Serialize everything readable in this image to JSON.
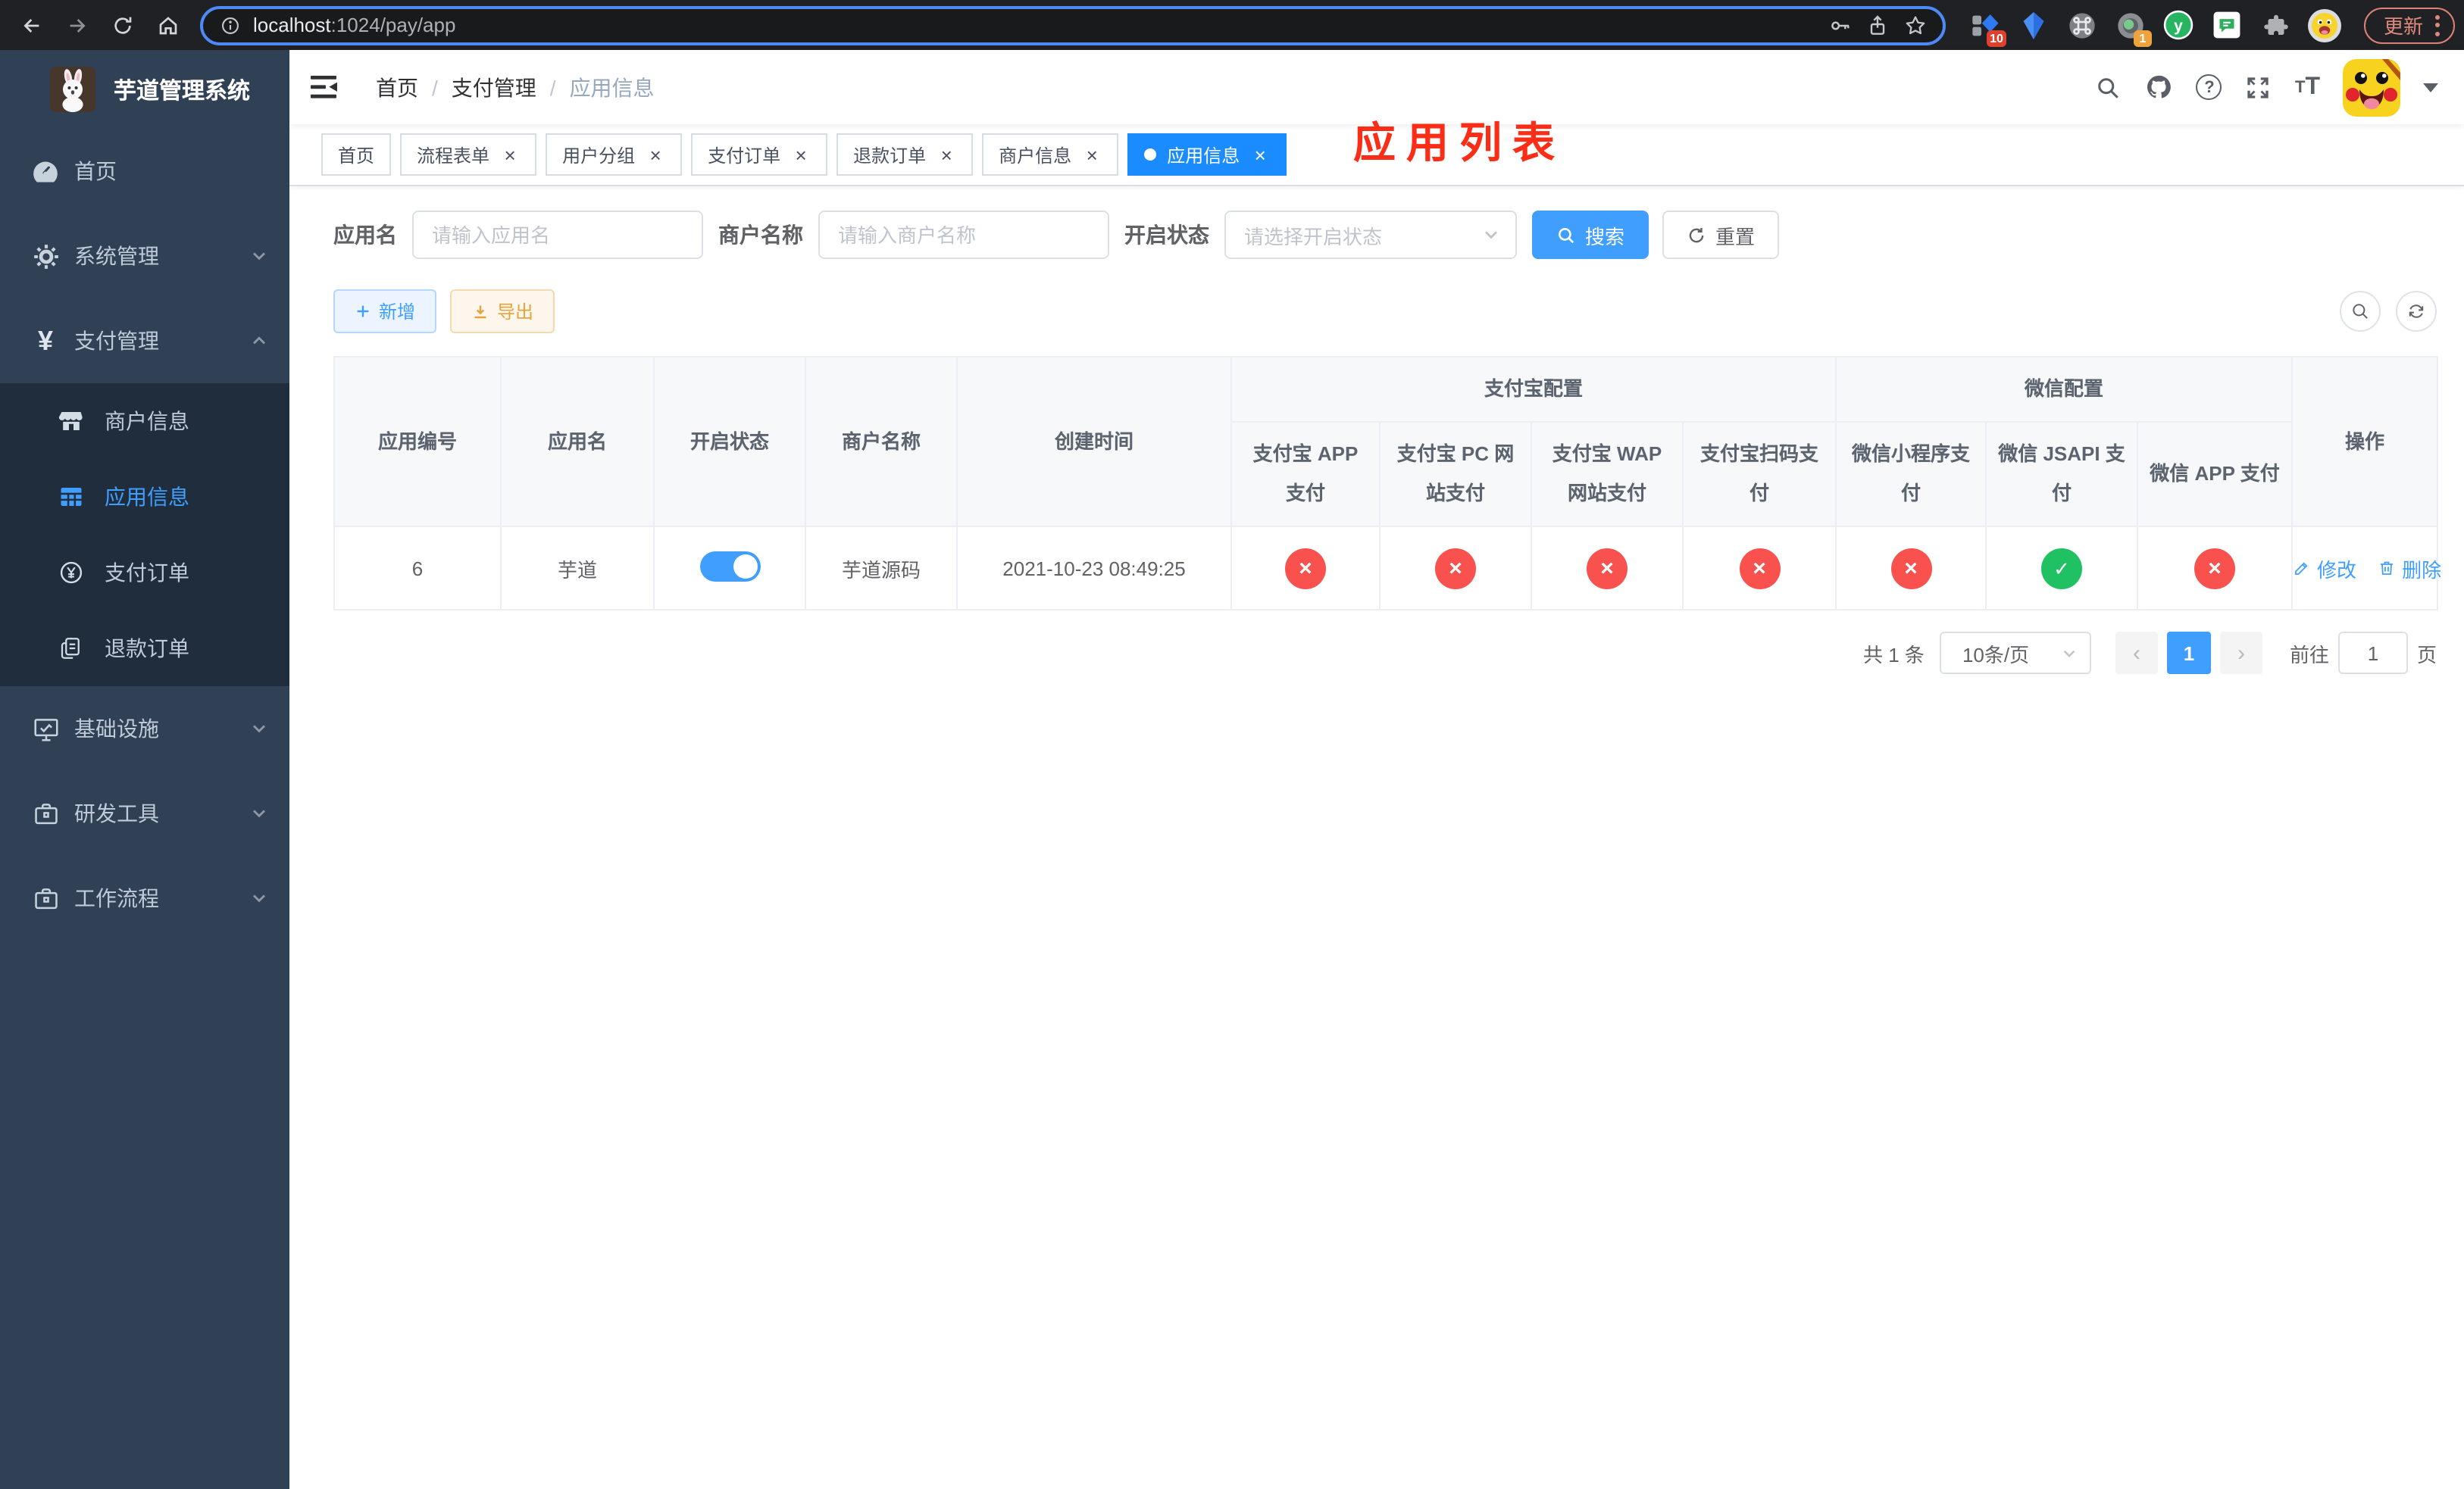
{
  "browser": {
    "url_host": "localhost",
    "url_path": ":1024/pay/app",
    "ext_badge_blue": "10",
    "ext_badge_lens": "1",
    "update_label": "更新"
  },
  "sidebar": {
    "title": "芋道管理系统",
    "items": [
      {
        "label": "首页"
      },
      {
        "label": "系统管理"
      },
      {
        "label": "支付管理"
      },
      {
        "label": "基础设施"
      },
      {
        "label": "研发工具"
      },
      {
        "label": "工作流程"
      }
    ],
    "pay_submenu": [
      {
        "label": "商户信息"
      },
      {
        "label": "应用信息"
      },
      {
        "label": "支付订单"
      },
      {
        "label": "退款订单"
      }
    ]
  },
  "navbar": {
    "breadcrumb": [
      "首页",
      "支付管理",
      "应用信息"
    ]
  },
  "header": {
    "page_title": "应用列表"
  },
  "tags": {
    "items": [
      {
        "label": "首页"
      },
      {
        "label": "流程表单"
      },
      {
        "label": "用户分组"
      },
      {
        "label": "支付订单"
      },
      {
        "label": "退款订单"
      },
      {
        "label": "商户信息"
      },
      {
        "label": "应用信息"
      }
    ]
  },
  "filters": {
    "app_name_label": "应用名",
    "app_name_placeholder": "请输入应用名",
    "merchant_label": "商户名称",
    "merchant_placeholder": "请输入商户名称",
    "status_label": "开启状态",
    "status_placeholder": "请选择开启状态",
    "search_label": "搜索",
    "reset_label": "重置"
  },
  "toolbar": {
    "add_label": "新增",
    "export_label": "导出"
  },
  "table": {
    "group_alipay": "支付宝配置",
    "group_wechat": "微信配置",
    "col_app_id": "应用编号",
    "col_app_name": "应用名",
    "col_status": "开启状态",
    "col_merchant": "商户名称",
    "col_create_time": "创建时间",
    "col_alipay_app": "支付宝 APP 支付",
    "col_alipay_pc": "支付宝 PC 网站支付",
    "col_alipay_wap": "支付宝 WAP 网站支付",
    "col_alipay_qr": "支付宝扫码支付",
    "col_wx_mini": "微信小程序支付",
    "col_wx_jsapi": "微信 JSAPI 支付",
    "col_wx_app": "微信 APP 支付",
    "col_actions": "操作",
    "row": {
      "app_id": "6",
      "app_name": "芋道",
      "enabled": "on",
      "merchant": "芋道源码",
      "create_time": "2021-10-23 08:49:25",
      "configs": [
        "no",
        "no",
        "no",
        "no",
        "no",
        "yes",
        "no"
      ],
      "edit_label": "修改",
      "delete_label": "删除"
    }
  },
  "pagination": {
    "total": "共 1 条",
    "page_size": "10条/页",
    "prev": "‹",
    "next": "›",
    "page": "1",
    "goto_label": "前往",
    "goto_value": "1",
    "unit_label": "页"
  },
  "colors": {
    "accent": "#409eff",
    "tab_active": "#1a8cff",
    "danger": "#f8514e",
    "success": "#1fc163",
    "title_red": "#fc2d17",
    "sidebar_bg": "#304156",
    "submenu_bg": "#1f2d3d"
  }
}
